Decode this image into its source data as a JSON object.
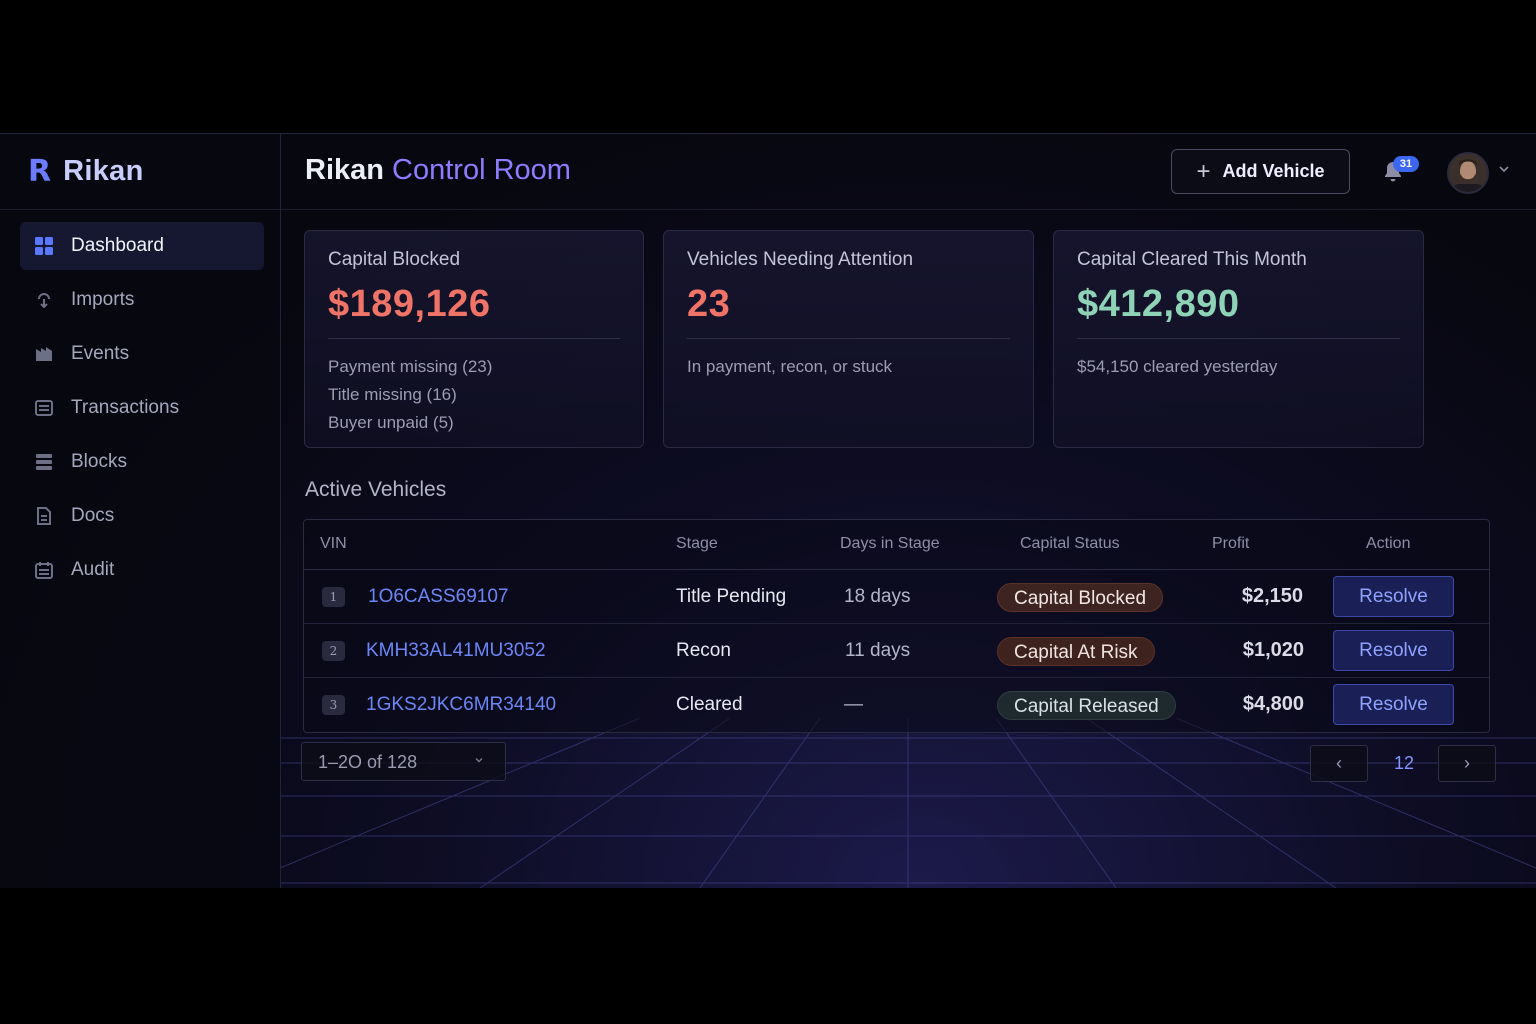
{
  "brand": {
    "mark": "R",
    "name": "Rikan"
  },
  "sidebar": {
    "items": [
      {
        "label": "Dashboard",
        "icon": "grid-icon",
        "active": true
      },
      {
        "label": "Imports",
        "icon": "import-icon"
      },
      {
        "label": "Events",
        "icon": "events-icon"
      },
      {
        "label": "Transactions",
        "icon": "transactions-icon"
      },
      {
        "label": "Blocks",
        "icon": "blocks-icon"
      },
      {
        "label": "Docs",
        "icon": "docs-icon"
      },
      {
        "label": "Audit",
        "icon": "audit-icon"
      }
    ]
  },
  "header": {
    "title_brand": "Rikan",
    "title_rest": "Control Room",
    "add_button": "Add Vehicle",
    "notification_count": "31"
  },
  "cards": {
    "blocked": {
      "title": "Capital Blocked",
      "value": "$189,126",
      "lines": [
        "Payment missing (23)",
        "Title missing (16)",
        "Buyer unpaid (5)"
      ]
    },
    "attention": {
      "title": "Vehicles Needing Attention",
      "value": "23",
      "line": "In payment, recon, or stuck"
    },
    "cleared": {
      "title": "Capital Cleared This Month",
      "value": "$412,890",
      "line": "$54,150 cleared yesterday"
    }
  },
  "section": {
    "title": "Active Vehicles"
  },
  "table": {
    "headers": {
      "vin": "VIN",
      "stage": "Stage",
      "days": "Days in Stage",
      "status": "Capital Status",
      "profit": "Profit",
      "action": "Action"
    },
    "rows": [
      {
        "index": "1",
        "vin": "1O6CASS69107",
        "stage": "Title Pending",
        "days": "18 days",
        "status": "Capital Blocked",
        "profit": "$2,150",
        "action": "Resolve"
      },
      {
        "index": "2",
        "vin": "KMH33AL41MU3052",
        "stage": "Recon",
        "days": "11 days",
        "status": "Capital At Risk",
        "profit": "$1,020",
        "action": "Resolve"
      },
      {
        "index": "3",
        "vin": "1GKS2JKC6MR34140",
        "stage": "Cleared",
        "days": "—",
        "status": "Capital Released",
        "profit": "$4,800",
        "action": "Resolve"
      }
    ]
  },
  "pagination": {
    "range": "1–2O of 128",
    "pages": "12",
    "prev": "‹",
    "next": "›"
  },
  "colors": {
    "accent": "#8d7cff",
    "link": "#6d86f6",
    "danger": "#f07368",
    "success": "#8fd3b6"
  }
}
